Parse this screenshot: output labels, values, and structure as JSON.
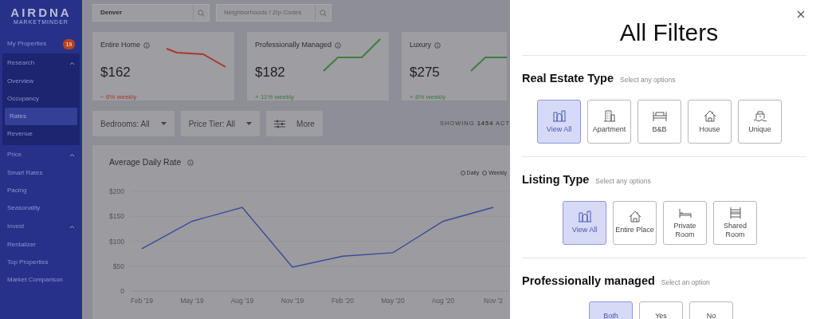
{
  "sidebar": {
    "logo": "AIRDNA",
    "logo_sub": "MARKETMINDER",
    "top_items": [
      {
        "label": "My Properties",
        "badge": "19",
        "selected": false
      }
    ],
    "groups": [
      {
        "label": "Research",
        "expanded": true,
        "active": true,
        "children": [
          {
            "label": "Overview",
            "selected": false
          },
          {
            "label": "Occupancy",
            "selected": false
          },
          {
            "label": "Rates",
            "selected": true
          },
          {
            "label": "Revenue",
            "selected": false
          }
        ]
      },
      {
        "label": "Price",
        "expanded": true,
        "active": false,
        "children": [
          {
            "label": "Smart Rates",
            "selected": false
          },
          {
            "label": "Pacing",
            "selected": false
          },
          {
            "label": "Seasonality",
            "selected": false
          }
        ]
      },
      {
        "label": "Invest",
        "expanded": true,
        "active": false,
        "children": [
          {
            "label": "Rentalizer",
            "selected": false
          },
          {
            "label": "Top Properties",
            "selected": false
          },
          {
            "label": "Market Comparison",
            "selected": false
          }
        ]
      }
    ]
  },
  "search": [
    {
      "value": "Denver"
    },
    {
      "placeholder": "Neighborhoods / Zip Codes"
    }
  ],
  "cards": [
    {
      "title": "Entire Home",
      "value": "$162",
      "change": "− 6% weekly",
      "color": "#a9392b"
    },
    {
      "title": "Professionally Managed",
      "value": "$182",
      "change": "+ 11% weekly",
      "color": "#3f7d3c"
    },
    {
      "title": "Luxury",
      "value": "$275",
      "change": "+ 8% weekly",
      "color": "#3f7d3c"
    }
  ],
  "filters": [
    {
      "kind": "dropdown",
      "label": "Bedrooms: All"
    },
    {
      "kind": "dropdown",
      "label": "Price Tier: All"
    },
    {
      "kind": "button",
      "label": "More"
    }
  ],
  "showing": "SHOWING **1454** ACT",
  "chart": {
    "title": "Average Daily Rate",
    "radios": [
      {
        "label": "Daily",
        "selected": false
      },
      {
        "label": "Weekly",
        "selected": false
      }
    ],
    "chart_data": {
      "type": "line",
      "categories": [
        "Feb '19",
        "May '19",
        "Aug '19",
        "Nov '19",
        "Feb '20",
        "May '20",
        "Aug '20",
        "Nov '2"
      ],
      "grid": true,
      "series": [
        {
          "color": "#3d4a9a",
          "values": [
            85,
            140,
            168,
            48,
            70,
            77,
            140,
            168
          ]
        }
      ],
      "ylim": [
        0,
        200
      ],
      "yticks": [
        {
          "value": 0,
          "label": "0"
        },
        {
          "value": 50,
          "label": "$50"
        },
        {
          "value": 100,
          "label": "$100"
        },
        {
          "value": 150,
          "label": "$150"
        },
        {
          "value": 200,
          "label": "$200"
        }
      ]
    }
  },
  "panel": {
    "title": "All Filters",
    "sections": [
      {
        "title": "Real Estate Type",
        "hint": "Select any options",
        "options": [
          {
            "label": "View All",
            "selected": true
          },
          {
            "label": "Apartment",
            "selected": false
          },
          {
            "label": "B&B",
            "selected": false
          },
          {
            "label": "House",
            "selected": false
          },
          {
            "label": "Unique",
            "selected": false
          }
        ]
      },
      {
        "title": "Listing Type",
        "hint": "Select any options",
        "options": [
          {
            "label": "View All",
            "selected": true
          },
          {
            "label": "Entire Place",
            "selected": false
          },
          {
            "label": "Private Room",
            "selected": false
          },
          {
            "label": "Shared Room",
            "selected": false
          }
        ]
      },
      {
        "title": "Professionally managed",
        "hint": "Select an option",
        "options": [
          {
            "label": "Both",
            "selected": true
          },
          {
            "label": "Yes",
            "selected": false
          },
          {
            "label": "No",
            "selected": false
          }
        ]
      }
    ]
  }
}
